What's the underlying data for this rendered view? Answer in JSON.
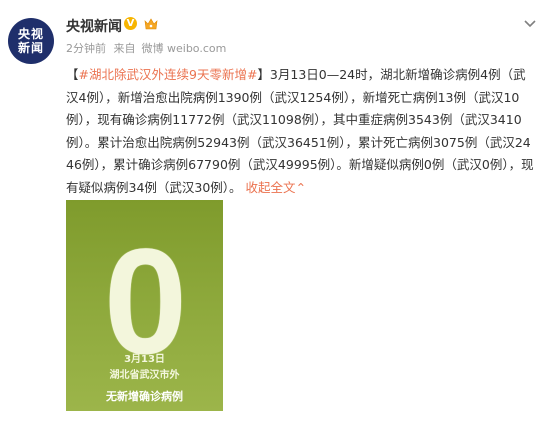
{
  "account": {
    "avatar_line1": "央视",
    "avatar_line2": "新闻",
    "name": "央视新闻",
    "verified_mark": "V",
    "time": "2分钟前",
    "from_label": "来自",
    "source": "微博 weibo.com"
  },
  "post": {
    "hashtag": "#湖北除武汉外连续9天零新增#",
    "body": "】3月13日0—24时，湖北新增确诊病例4例（武汉4例），新增治愈出院病例1390例（武汉1254例），新增死亡病例13例（武汉10例），现有确诊病例11772例（武汉11098例），其中重症病例3543例（武汉3410例）。累计治愈出院病例52943例（武汉36451例），累计死亡病例3075例（武汉2446例），累计确诊病例67790例（武汉49995例）。新增疑似病例0例（武汉0例），现有疑似病例34例（武汉30例）。",
    "bracket_open": "【",
    "collapse_label": "收起全文",
    "collapse_arrow": "⌃"
  },
  "image": {
    "big_number": "0",
    "date": "3月13日",
    "region": "湖北省武汉市外",
    "caption": "无新增确诊病例"
  },
  "colors": {
    "link": "#eb7350",
    "avatar_bg": "#1f2f6b",
    "image_green": "#8ea93c"
  }
}
